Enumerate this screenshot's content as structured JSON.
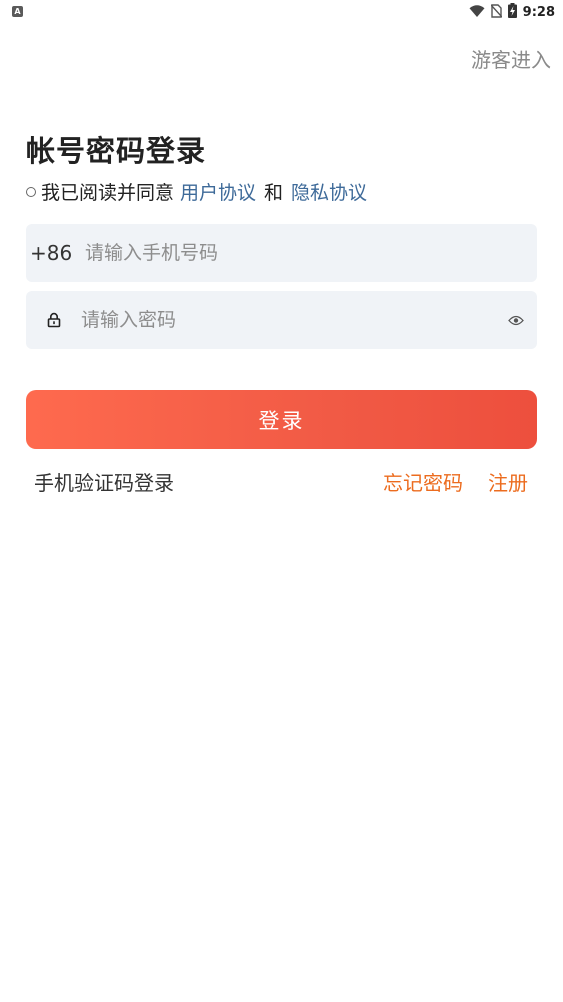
{
  "status_bar": {
    "app_icon_glyph": "A",
    "time": "9:28",
    "icons": [
      "wifi-icon",
      "no-sim-icon",
      "battery-charging-icon"
    ]
  },
  "header": {
    "guest_label": "游客进入"
  },
  "title": "帐号密码登录",
  "agreement": {
    "prefix": "我已阅读并同意",
    "user_agreement": "用户协议",
    "and": "和",
    "privacy_policy": "隐私协议"
  },
  "phone_field": {
    "country_code": "+86",
    "placeholder": "请输入手机号码",
    "value": ""
  },
  "password_field": {
    "placeholder": "请输入密码",
    "value": ""
  },
  "login_button": "登录",
  "links": {
    "sms_login": "手机验证码登录",
    "forgot_password": "忘记密码",
    "register": "注册"
  },
  "colors": {
    "link_blue": "#3e6a99",
    "link_orange": "#ec6c1f",
    "button_start": "#fe6a4e",
    "button_end": "#ed4f3d",
    "field_background": "#f0f3f7"
  }
}
